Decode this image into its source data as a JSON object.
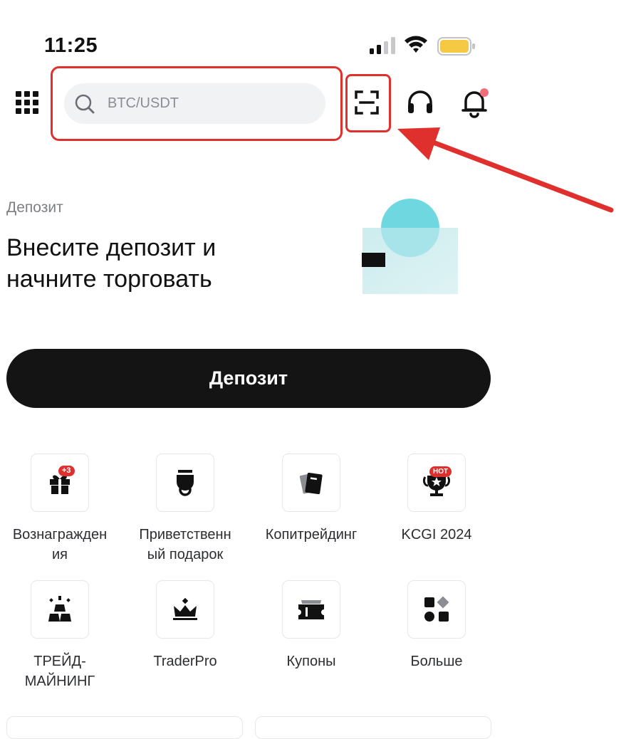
{
  "status_bar": {
    "time": "11:25"
  },
  "header": {
    "search_placeholder": "BTC/USDT",
    "icons": [
      "apps-grid-icon",
      "search-icon",
      "scan-icon",
      "headset-icon",
      "bell-icon"
    ]
  },
  "banner": {
    "label": "Депозит",
    "headline_line1": "Внесите депозит и",
    "headline_line2": "начните торговать",
    "cta": "Депозит"
  },
  "tiles": [
    {
      "label_l1": "Вознагражден",
      "label_l2": "ия",
      "icon": "gift-icon",
      "badge": "+3"
    },
    {
      "label_l1": "Приветственн",
      "label_l2": "ый подарок",
      "icon": "medal-icon"
    },
    {
      "label_l1": "Копитрейдинг",
      "label_l2": "",
      "icon": "copy-trade-icon"
    },
    {
      "label_l1": "KCGI 2024",
      "label_l2": "",
      "icon": "trophy-icon",
      "badge": "HOT"
    },
    {
      "label_l1": "ТРЕЙД-",
      "label_l2": "МАЙНИНГ",
      "icon": "gold-bars-icon"
    },
    {
      "label_l1": "TraderPro",
      "label_l2": "",
      "icon": "crown-icon"
    },
    {
      "label_l1": "Купоны",
      "label_l2": "",
      "icon": "coupon-icon"
    },
    {
      "label_l1": "Больше",
      "label_l2": "",
      "icon": "more-shapes-icon"
    }
  ],
  "colors": {
    "accent_red": "#e0302e",
    "cta_bg": "#141414",
    "battery": "#f6c945",
    "illus_teal": "#5fd3dd"
  }
}
